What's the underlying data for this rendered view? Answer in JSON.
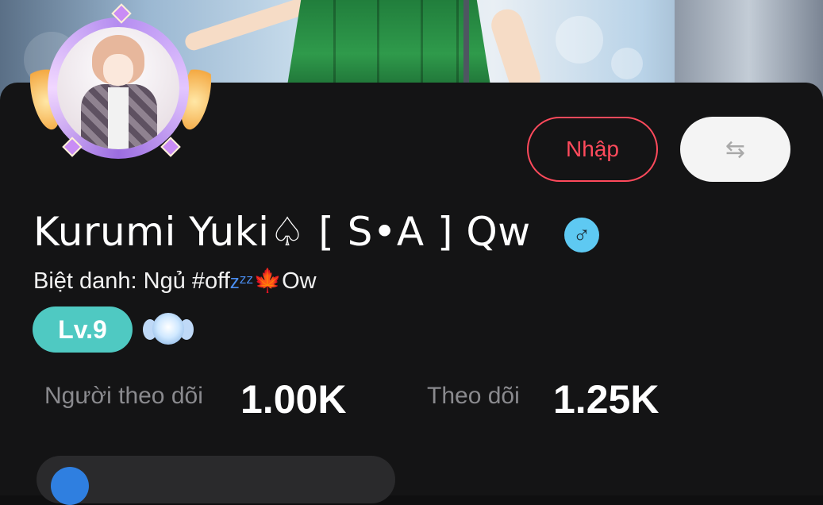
{
  "profile": {
    "display_name": "Kurumi Yuki♤ [ S•A ] Qw",
    "gender_symbol": "♂",
    "nickname_label": "Biệt danh: Ngủ #off",
    "nickname_zzz": "zᶻᶻ",
    "nickname_leaf": "🍁",
    "nickname_suffix": "Ow",
    "level": "Lv.9"
  },
  "actions": {
    "import_label": "Nhập",
    "switch_icon": "⇆"
  },
  "stats": {
    "followers_label": "Người theo dõi",
    "followers_value": "1.00K",
    "following_label": "Theo dõi",
    "following_value": "1.25K"
  },
  "colors": {
    "accent_red": "#ff4a5c",
    "level_teal": "#4fc9c2",
    "gender_blue": "#5ec9f2",
    "background": "#141415"
  },
  "icons": [
    "avatar-frame",
    "gender-male-icon",
    "switch-arrows-icon",
    "angel-badge-icon",
    "maple-leaf-icon"
  ]
}
